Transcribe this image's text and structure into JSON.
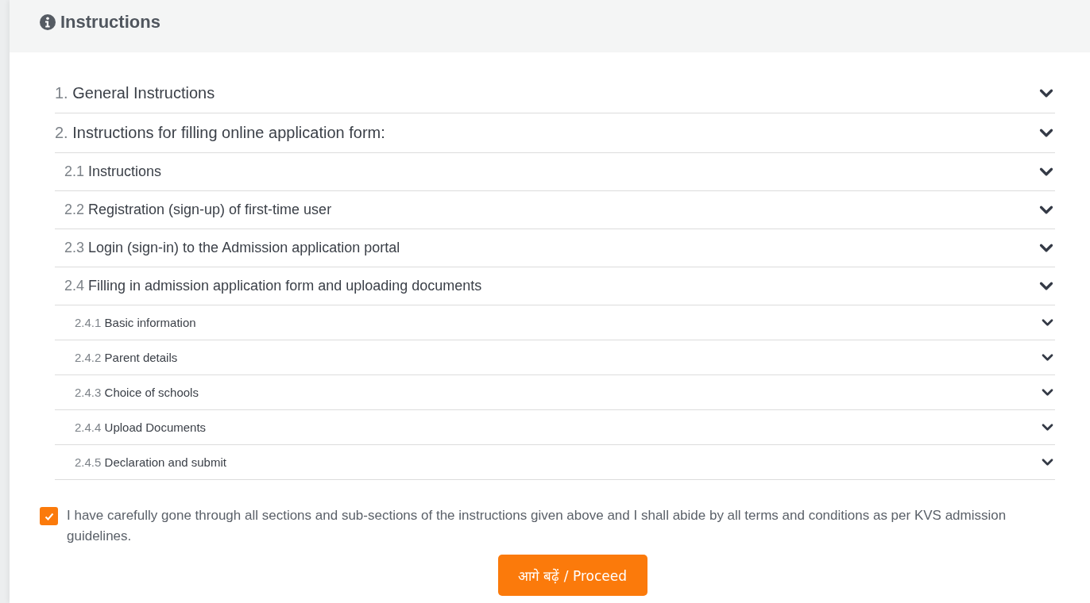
{
  "panel": {
    "title": "Instructions"
  },
  "sections": [
    {
      "number": "1.",
      "title": "General Instructions"
    },
    {
      "number": "2.",
      "title": "Instructions for filling online application form:",
      "children": [
        {
          "number": "2.1",
          "title": "Instructions"
        },
        {
          "number": "2.2",
          "title": "Registration (sign-up) of first-time user"
        },
        {
          "number": "2.3",
          "title": "Login (sign-in) to the Admission application portal"
        },
        {
          "number": "2.4",
          "title": "Filling in admission application form and uploading documents",
          "children": [
            {
              "number": "2.4.1",
              "title": "Basic information"
            },
            {
              "number": "2.4.2",
              "title": "Parent details"
            },
            {
              "number": "2.4.3",
              "title": "Choice of schools"
            },
            {
              "number": "2.4.4",
              "title": "Upload Documents"
            },
            {
              "number": "2.4.5",
              "title": "Declaration and submit"
            }
          ]
        }
      ]
    }
  ],
  "agreement": {
    "checked": true,
    "text": "I have carefully gone through all sections and sub-sections of the instructions given above and I shall abide by all terms and conditions as per KVS admission guidelines."
  },
  "proceed_button": "आगे बढ़ें / Proceed"
}
